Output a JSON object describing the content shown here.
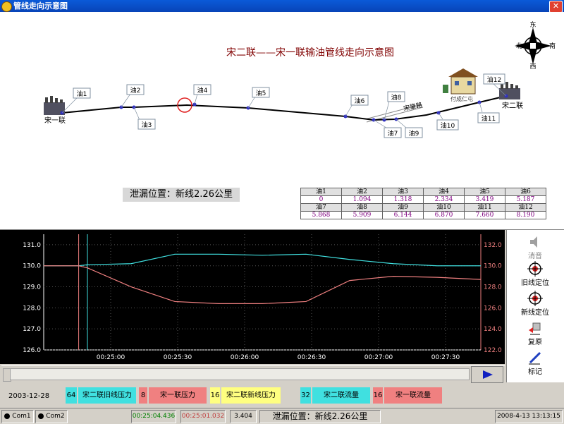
{
  "window": {
    "title": "管线走向示意图"
  },
  "map": {
    "title": "宋二联——宋一联输油管线走向示意图",
    "compass": {
      "n": "东",
      "s": "西",
      "w": "北",
      "e": "南"
    },
    "stations": {
      "left": "宋一联",
      "right": "宋二联",
      "village": "付成仁屯"
    },
    "road": "宋肇路",
    "points": [
      "油1",
      "油2",
      "油3",
      "油4",
      "油5",
      "油6",
      "油7",
      "油8",
      "油9",
      "油10",
      "油11",
      "油12"
    ],
    "leak_label": "泄漏位置：新线2.26公里"
  },
  "oil_table": {
    "rows": [
      {
        "names": [
          "油1",
          "油2",
          "油3",
          "油4",
          "油5",
          "油6"
        ],
        "values": [
          "0",
          "1.094",
          "1.318",
          "2.334",
          "3.419",
          "5.187"
        ]
      },
      {
        "names": [
          "油7",
          "油8",
          "油9",
          "油10",
          "油11",
          "油12"
        ],
        "values": [
          "5.868",
          "5.909",
          "6.144",
          "6.870",
          "7.660",
          "8.190"
        ]
      }
    ]
  },
  "chart_data": {
    "type": "line",
    "x_ticks": [
      "00:25:00",
      "00:25:30",
      "00:26:00",
      "00:26:30",
      "00:27:00",
      "00:27:30"
    ],
    "y_left_ticks": [
      "131.0",
      "130.0",
      "129.0",
      "128.0",
      "127.0",
      "126.0"
    ],
    "y_right_ticks": [
      "132.0",
      "130.0",
      "128.0",
      "126.0",
      "124.0",
      "122.0"
    ],
    "ylim_left": [
      126.0,
      131.5
    ],
    "ylim_right": [
      122.0,
      133.0
    ],
    "series": [
      {
        "color": "#40e0e0",
        "axis": "left",
        "x": [
          0,
          8,
          10,
          20,
          30,
          40,
          50,
          60,
          70,
          80,
          90,
          100
        ],
        "values": [
          130.0,
          130.0,
          130.05,
          130.1,
          130.55,
          130.55,
          130.5,
          130.55,
          130.3,
          130.1,
          130.0,
          130.0
        ]
      },
      {
        "color": "#f08080",
        "axis": "left",
        "x": [
          0,
          8,
          10,
          20,
          30,
          40,
          50,
          60,
          70,
          80,
          90,
          100
        ],
        "values": [
          130.0,
          130.0,
          129.9,
          129.0,
          128.3,
          128.2,
          128.2,
          128.3,
          129.3,
          129.5,
          129.45,
          129.35
        ]
      }
    ],
    "cursors": [
      {
        "x": 8,
        "color": "#f08080"
      },
      {
        "x": 10,
        "color": "#40e0e0"
      }
    ]
  },
  "sidebar": {
    "items": [
      "消音",
      "旧线定位",
      "新线定位",
      "复原",
      "标记"
    ]
  },
  "legend": {
    "date": "2003-12-28",
    "items": [
      {
        "num": "64",
        "name": "宋二联旧线压力",
        "color": "#40e0e0"
      },
      {
        "num": "8",
        "name": "宋一联压力",
        "color": "#f08080"
      },
      {
        "num": "16",
        "name": "宋二联新线压力",
        "color": "#ffff80"
      },
      {
        "num": "32",
        "name": "宋二联流量",
        "color": "#40e0e0"
      },
      {
        "num": "16",
        "name": "宋一联流量",
        "color": "#f08080"
      }
    ]
  },
  "status": {
    "com1": "Com1",
    "com2": "Com2",
    "time1": "00:25:04.436",
    "time2": "00:25:01.032",
    "value": "3.404",
    "leak": "泄漏位置：新线2.26公里",
    "datetime": "2008-4-13 13:13:15"
  }
}
